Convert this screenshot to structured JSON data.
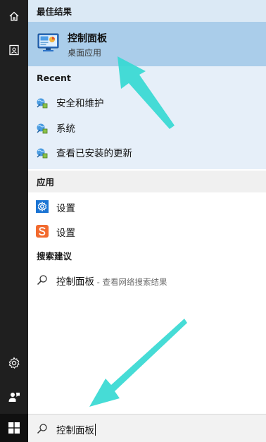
{
  "best_match": {
    "header": "最佳结果",
    "title": "控制面板",
    "subtitle": "桌面应用"
  },
  "recent": {
    "header": "Recent",
    "items": [
      {
        "label": "安全和维护",
        "icon": "control-panel-item-icon"
      },
      {
        "label": "系统",
        "icon": "control-panel-item-icon"
      },
      {
        "label": "查看已安装的更新",
        "icon": "control-panel-item-icon"
      }
    ]
  },
  "apps": {
    "header": "应用",
    "items": [
      {
        "label": "设置",
        "icon": "settings-gear-icon"
      },
      {
        "label": "设置",
        "icon": "sogou-s-icon"
      }
    ]
  },
  "suggestions": {
    "header": "搜索建议",
    "query": "控制面板",
    "hint": " - 查看网络搜索结果"
  },
  "searchbox": {
    "value": "控制面板"
  },
  "colors": {
    "rail": "#1f1f1f",
    "best_item": "#aacdea",
    "best_block": "#dbe9f5",
    "recent_block": "#e6eff9",
    "arrow": "#36d9d2"
  },
  "rail_icons": [
    "home-icon",
    "notebook-icon",
    "settings-icon",
    "feedback-icon"
  ]
}
